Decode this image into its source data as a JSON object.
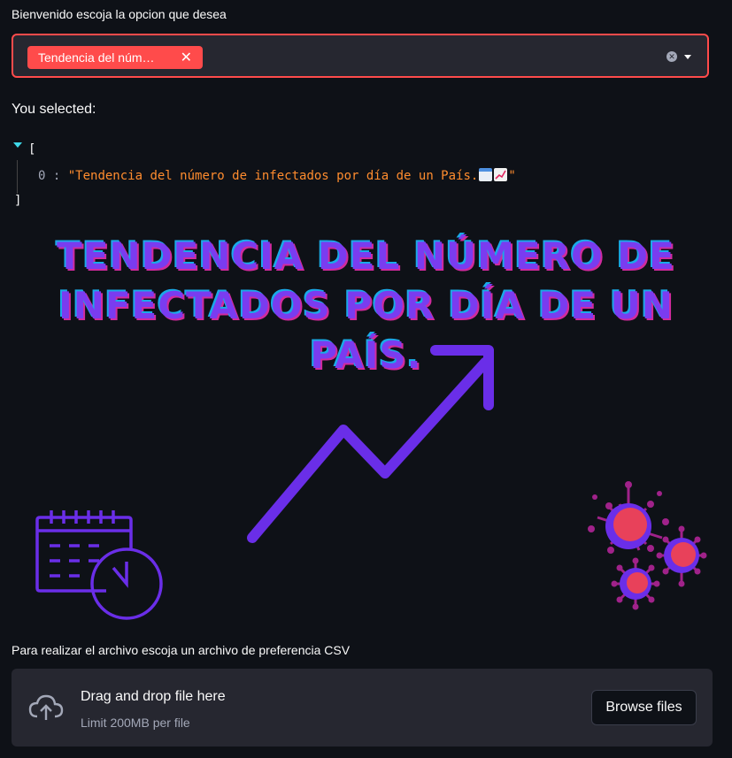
{
  "prompt": {
    "label": "Bienvenido escoja la opcion que desea"
  },
  "multiselect": {
    "chip_label": "Tendencia del núm…",
    "chip_remove_icon": "✕",
    "clear_icon": "✕",
    "accent_color": "#ff4b4b"
  },
  "selection": {
    "heading": "You selected:",
    "json_open": "[",
    "json_close": "]",
    "items": [
      {
        "index": "0",
        "value": "\"Tendencia del número de infectados por día de un País.",
        "value_end": "\""
      }
    ]
  },
  "hero": {
    "title_line1": "TENDENCIA DEL NÚMERO DE",
    "title_line2": "INFECTADOS POR DÍA DE UN PAÍS.",
    "colors": {
      "purple": "#7a3cf0",
      "virus": "#e8415a"
    }
  },
  "uploader": {
    "label": "Para realizar el archivo escoja un archivo de preferencia CSV",
    "drag_text": "Drag and drop file here",
    "limit_text": "Limit 200MB per file",
    "browse_label": "Browse files"
  }
}
